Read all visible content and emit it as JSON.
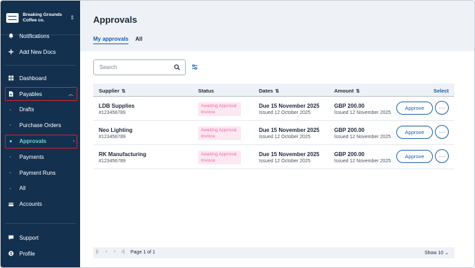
{
  "org": {
    "name_line1": "Breaking Grounds",
    "name_line2": "Coffee co.",
    "switch_icon": "chevron-up-down-icon"
  },
  "sidebar": {
    "items": [
      {
        "key": "notifications",
        "label": "Notifications",
        "icon": "bell-icon"
      },
      {
        "key": "add-new-docs",
        "label": "Add New Docs",
        "icon": "plus-icon"
      },
      {
        "key": "dashboard",
        "label": "Dashboard",
        "icon": "dashboard-icon"
      },
      {
        "key": "payables",
        "label": "Payables",
        "icon": "document-icon"
      },
      {
        "key": "drafts",
        "label": "Drafts"
      },
      {
        "key": "purchase-orders",
        "label": "Purchase Orders"
      },
      {
        "key": "approvals",
        "label": "Approvals"
      },
      {
        "key": "payments",
        "label": "Payments"
      },
      {
        "key": "payment-runs",
        "label": "Payment Runs"
      },
      {
        "key": "all",
        "label": "All"
      },
      {
        "key": "accounts",
        "label": "Accounts",
        "icon": "wallet-icon"
      },
      {
        "key": "support",
        "label": "Support",
        "icon": "chat-icon"
      },
      {
        "key": "profile",
        "label": "Profile",
        "icon": "dollar-icon"
      }
    ]
  },
  "page": {
    "title": "Approvals"
  },
  "tabs": [
    {
      "label": "My approvals",
      "active": true
    },
    {
      "label": "All",
      "active": false
    }
  ],
  "search": {
    "placeholder": "Search"
  },
  "table": {
    "headers": {
      "supplier": "Supplier",
      "status": "Status",
      "dates": "Dates",
      "amount": "Amount",
      "select": "Select"
    },
    "rows": [
      {
        "supplier": "LDB Supplies",
        "id": "#123456789",
        "status_line1": "Awaiting Approval",
        "status_line2": "Invoice",
        "due": "Due 15 November 2025",
        "issued": "Issued 12 October 2025",
        "amount": "GBP 200.00",
        "amount_issued": "Issued 12 November 2025",
        "approve": "Approve",
        "more": "···"
      },
      {
        "supplier": "Neo Lighting",
        "id": "#123456789",
        "status_line1": "Awaiting Approval",
        "status_line2": "Invoice",
        "due": "Due 15 November 2025",
        "issued": "Issued 12 October 2025",
        "amount": "GBP 200.00",
        "amount_issued": "Issued 12 November 2025",
        "approve": "Approve",
        "more": "···"
      },
      {
        "supplier": "RK Manufacturing",
        "id": "#123456789",
        "status_line1": "Awaiting Approval",
        "status_line2": "Invoice",
        "due": "Due 15 November 2025",
        "issued": "Issued 12 October 2025",
        "amount": "GBP 200.00",
        "amount_issued": "Issued 12 November 2025",
        "approve": "Approve",
        "more": "···"
      }
    ]
  },
  "pagination": {
    "first": "|‹",
    "prev": "‹",
    "next": "›",
    "last": "›|",
    "page_text": "Page 1 of 1",
    "show": "Show 10 ⌄"
  },
  "colors": {
    "sidebar_bg": "#13304f",
    "accent": "#1c5ea8",
    "active_teal": "#6fd3cf",
    "highlight_red": "#d6232a",
    "status_pink": "#f06aa6"
  }
}
